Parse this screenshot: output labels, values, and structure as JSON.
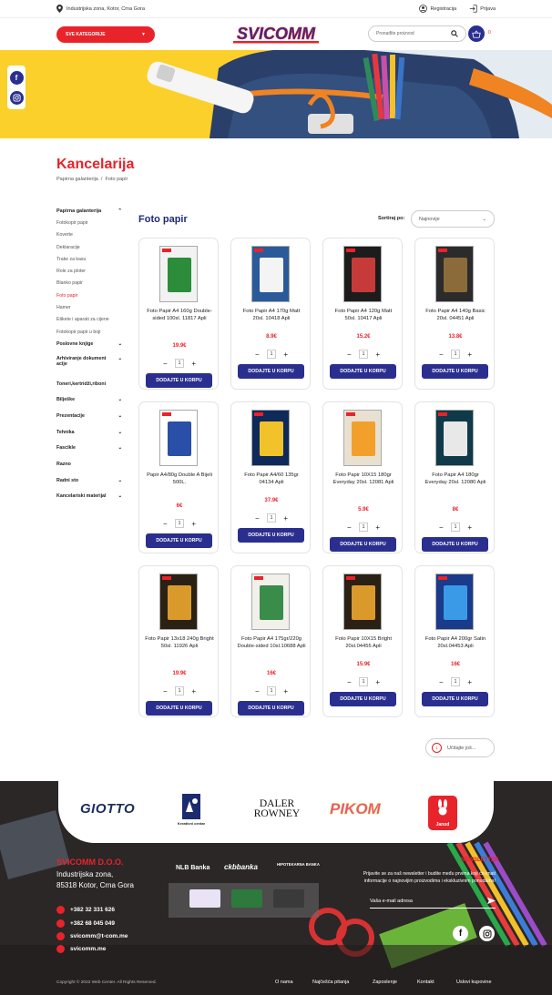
{
  "topbar": {
    "address": "Industrijska zona, Kotor, Crna Gora",
    "register": "Registracija",
    "login": "Prijava"
  },
  "header": {
    "categories_button": "SVE KATEGORIJE",
    "logo_text": "SVICOMM",
    "search_placeholder": "Pronađite proizvod",
    "cart_count": "0"
  },
  "page": {
    "title": "Kancelarija",
    "breadcrumb": [
      "Papirna galanterija",
      "Foto papir"
    ],
    "list_title": "Foto papir",
    "sort_label": "Sortiraj po:",
    "sort_value": "Najnovije",
    "load_more": "Učitajte još..."
  },
  "sidebar": {
    "group": "Papirna galanterija",
    "subitems": [
      "Fotokopir papir",
      "Koverte",
      "Deklaracije",
      "Trake za kasu",
      "Role za ploter",
      "Blanko papir",
      "Foto papir",
      "Hamer",
      "Etikete i aparati za cijene",
      "Fotokopir papir u boji"
    ],
    "active_index": 6,
    "categories": [
      "Poslovne knjige",
      "Arhiviranje dokument acije",
      "Toneri,kertridži,riboni",
      "Bilješke",
      "Prezentacije",
      "Tehnika",
      "Fascikle",
      "Razno",
      "Radni sto",
      "Kancelariski materijal"
    ]
  },
  "products": [
    {
      "name": "Foto Papir A4 160g Double-sided 100sl. 11817 Apli",
      "price": "19.9€",
      "qty": "1",
      "button": "DODAJTE U KORPU"
    },
    {
      "name": "Foto Papir A4 170g Matt 20sl. 10418 Apli",
      "price": "8.9€",
      "qty": "1",
      "button": "DODAJTE U KORPU"
    },
    {
      "name": "Foto Papir A4 120g Matt 50sl. 10417 Apli",
      "price": "15.2€",
      "qty": "1",
      "button": "DODAJTE U KORPU"
    },
    {
      "name": "Foto Papir A4 140g Basic 20sl. 04451 Apli",
      "price": "13.8€",
      "qty": "1",
      "button": "DODAJTE U KORPU"
    },
    {
      "name": "Papir A4/80g Double A Bijeli 500L.",
      "price": "6€",
      "qty": "1",
      "button": "DODAJTE U KORPU"
    },
    {
      "name": "Foto Papir A4/60 135gr 04134 Apli",
      "price": "37.9€",
      "qty": "1",
      "button": "DODAJTE U KORPU"
    },
    {
      "name": "Foto Papir 10X15 180gr Everyday 20sl. 12081 Apli",
      "price": "5.9€",
      "qty": "1",
      "button": "DODAJTE U KORPU"
    },
    {
      "name": "Foto Papir A4 180gr Everyday 20sl. 12080 Apli",
      "price": "8€",
      "qty": "1",
      "button": "DODAJTE U KORPU"
    },
    {
      "name": "Foto Papir 13x18 240g Bright 50sl. 11926 Apli",
      "price": "19.9€",
      "qty": "1",
      "button": "DODAJTE U KORPU"
    },
    {
      "name": "Foto Papir A4 175gr/220g Double-sided 10sl.10688 Apli",
      "price": "16€",
      "qty": "1",
      "button": "DODAJTE U KORPU"
    },
    {
      "name": "Foto Papir 10X15 Bright 20sl.04455 Apli",
      "price": "15.9€",
      "qty": "1",
      "button": "DODAJTE U KORPU"
    },
    {
      "name": "Foto Papir A4 200gr Satin 20sl.04453 Apli",
      "price": "16€",
      "qty": "1",
      "button": "DODAJTE U KORPU"
    }
  ],
  "brands": [
    "GIOTTO",
    "Kreativni centar",
    "DALER ROWNEY",
    "PIKOM",
    "Janod"
  ],
  "footer": {
    "company": "SVICOMM D.O.O.",
    "address1": "Industrijska zona,",
    "address2": "85318 Kotor, Crna Gora",
    "phone1": "+382 32 331 626",
    "phone2": "+382 68 045 049",
    "email": "svicomm@t-com.me",
    "web": "svicomm.me",
    "banks": [
      "NLB Banka",
      "ckbbanka",
      "HIPOTEKARNA BANKA"
    ],
    "newsletter_title": "NEWSLETTER",
    "newsletter_text": "Prijavite se za naš newsletter i budite među prvima koji će imati informacije o najnovijim proizvodima i ekskluzivnim ponudama!",
    "newsletter_placeholder": "Vaša e-mail adresa",
    "copyright": "Copyright © 2022 Web Center. All Rights Reserved.",
    "nav": [
      "O nama",
      "Najčešća pitanja",
      "Zaposlenje",
      "Kontakt",
      "Uslovi kupovine"
    ]
  },
  "colors": {
    "brand_red": "#e8232a",
    "brand_blue": "#2a2f8f"
  }
}
